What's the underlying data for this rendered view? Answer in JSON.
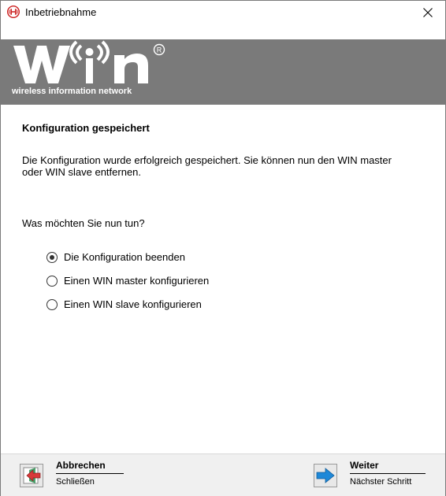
{
  "window": {
    "title": "Inbetriebnahme"
  },
  "banner": {
    "logo_text": "WIN",
    "tagline": "wireless information network"
  },
  "content": {
    "heading": "Konfiguration gespeichert",
    "description_line1": "Die Konfiguration wurde erfolgreich gespeichert. Sie können nun den WIN master",
    "description_line2": "oder WIN slave entfernen.",
    "question": "Was möchten Sie nun tun?",
    "options": [
      {
        "label": "Die Konfiguration beenden",
        "selected": true
      },
      {
        "label": "Einen WIN master konfigurieren",
        "selected": false
      },
      {
        "label": "Einen WIN slave konfigurieren",
        "selected": false
      }
    ]
  },
  "footer": {
    "cancel_title": "Abbrechen",
    "cancel_sub": "Schließen",
    "next_title": "Weiter",
    "next_sub": "Nächster Schritt"
  },
  "colors": {
    "banner_bg": "#7a7a7a",
    "footer_bg": "#f0f0f0",
    "next_arrow": "#1e88d8",
    "cancel_arrow": "#d83a3a"
  }
}
